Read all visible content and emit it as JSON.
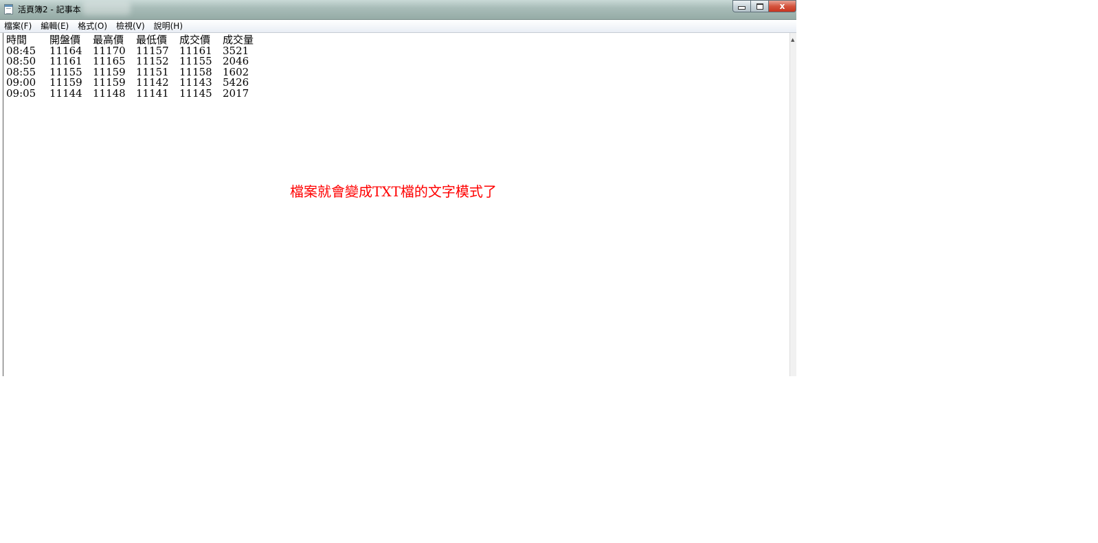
{
  "window": {
    "title": "活頁簿2 - 記事本",
    "app_icon": "notepad-icon",
    "controls": {
      "minimize_icon": "minimize-icon",
      "maximize_icon": "maximize-icon",
      "close_label": "x",
      "close_icon": "close-icon"
    }
  },
  "menubar": {
    "items": [
      {
        "label": "檔案(F)"
      },
      {
        "label": "編輯(E)"
      },
      {
        "label": "格式(O)"
      },
      {
        "label": "檢視(V)"
      },
      {
        "label": "說明(H)"
      }
    ]
  },
  "document": {
    "headers": [
      "時間",
      "開盤價",
      "最高價",
      "最低價",
      "成交價",
      "成交量"
    ],
    "rows": [
      [
        "08:45",
        "11164",
        "11170",
        "11157",
        "11161",
        "3521"
      ],
      [
        "08:50",
        "11161",
        "11165",
        "11152",
        "11155",
        "2046"
      ],
      [
        "08:55",
        "11155",
        "11159",
        "11151",
        "11158",
        "1602"
      ],
      [
        "09:00",
        "11159",
        "11159",
        "11142",
        "11143",
        "5426"
      ],
      [
        "09:05",
        "11144",
        "11148",
        "11141",
        "11145",
        "2017"
      ]
    ]
  },
  "annotation": {
    "text": "檔案就會變成TXT檔的文字模式了",
    "color": "#ff0000"
  }
}
